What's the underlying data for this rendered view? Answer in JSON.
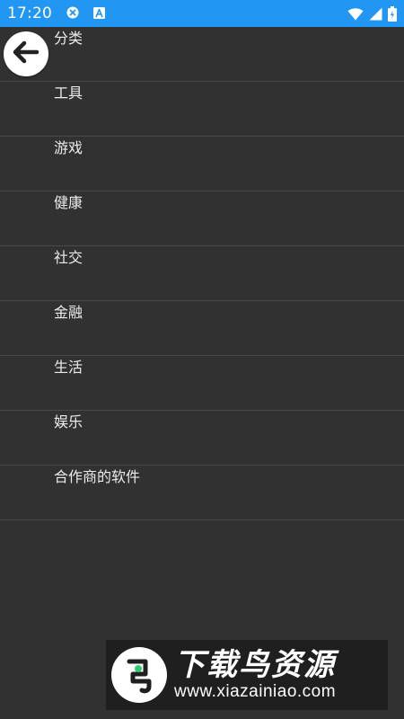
{
  "status_bar": {
    "time": "17:20",
    "background_color": "#2196f3",
    "left_icons": [
      "close-circle-icon",
      "a-text-icon"
    ],
    "right_icons": [
      "wifi-icon",
      "signal-icon",
      "battery-icon"
    ]
  },
  "back_button": {
    "icon": "arrow-left-icon"
  },
  "categories": [
    {
      "label": "分类"
    },
    {
      "label": "工具"
    },
    {
      "label": "游戏"
    },
    {
      "label": "健康"
    },
    {
      "label": "社交"
    },
    {
      "label": "金融"
    },
    {
      "label": "生活"
    },
    {
      "label": "娱乐"
    },
    {
      "label": "合作商的软件"
    }
  ],
  "watermark": {
    "title": "下载鸟资源",
    "url": "www.xiazainiao.com"
  },
  "colors": {
    "background": "#313131",
    "divider": "#4a4a4a",
    "text": "#ececec"
  }
}
